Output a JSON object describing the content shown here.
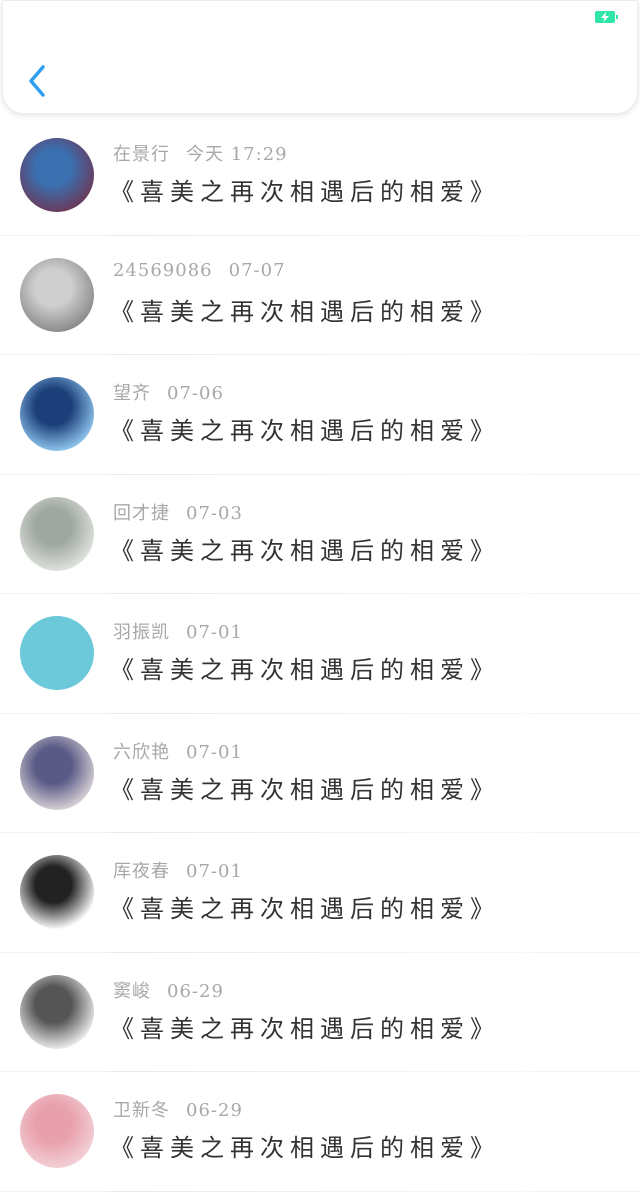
{
  "header": {
    "back_icon": "chevron-left-icon",
    "battery_icon": "battery-charging-icon",
    "accent": "#2e9ff0",
    "battery_color": "#2ee6a8"
  },
  "list": [
    {
      "name": "在景行",
      "date": "今天 17:29",
      "title": "《喜美之再次相遇后的相爱》",
      "avatar_colors": [
        "#6a3a5a",
        "#3a6fb0"
      ]
    },
    {
      "name": "24569086",
      "date": "07-07",
      "title": "《喜美之再次相遇后的相爱》",
      "avatar_colors": [
        "#8a8a8a",
        "#cfcfcf"
      ]
    },
    {
      "name": "望齐",
      "date": "07-06",
      "title": "《喜美之再次相遇后的相爱》",
      "avatar_colors": [
        "#8fc6ee",
        "#1c3f7a"
      ]
    },
    {
      "name": "回才捷",
      "date": "07-03",
      "title": "《喜美之再次相遇后的相爱》",
      "avatar_colors": [
        "#dfe3dd",
        "#9fa8a0"
      ]
    },
    {
      "name": "羽振凯",
      "date": "07-01",
      "title": "《喜美之再次相遇后的相爱》",
      "avatar_colors": [
        "#6cc9d9",
        "#6cc9d9"
      ]
    },
    {
      "name": "六欣艳",
      "date": "07-01",
      "title": "《喜美之再次相遇后的相爱》",
      "avatar_colors": [
        "#d8d2d6",
        "#5a5a86"
      ]
    },
    {
      "name": "厍夜春",
      "date": "07-01",
      "title": "《喜美之再次相遇后的相爱》",
      "avatar_colors": [
        "#ffffff",
        "#222222"
      ]
    },
    {
      "name": "窦峻",
      "date": "06-29",
      "title": "《喜美之再次相遇后的相爱》",
      "avatar_colors": [
        "#eeeeee",
        "#555555"
      ]
    },
    {
      "name": "卫新冬",
      "date": "06-29",
      "title": "《喜美之再次相遇后的相爱》",
      "avatar_colors": [
        "#f3d0d6",
        "#e8a0ac"
      ]
    }
  ]
}
